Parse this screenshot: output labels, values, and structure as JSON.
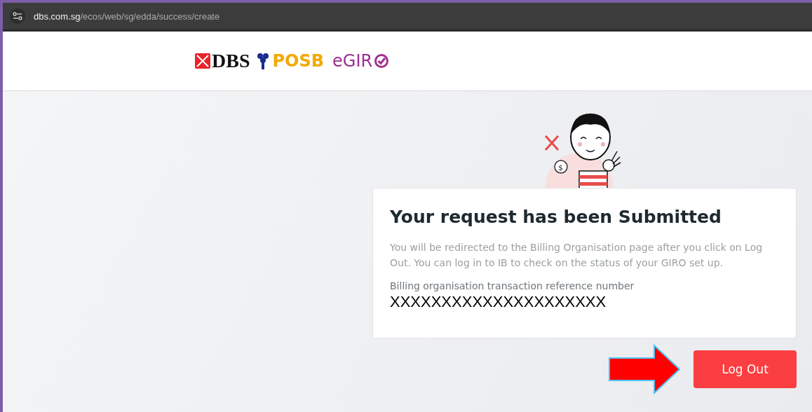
{
  "browser": {
    "url_host": "dbs.com.sg",
    "url_path": "/ecos/web/sg/edda/success/create"
  },
  "header": {
    "logos": [
      {
        "text": "DBS",
        "kind": "dbs"
      },
      {
        "text": "POSB",
        "kind": "posb"
      },
      {
        "text": "eGIR",
        "kind": "egiro"
      }
    ]
  },
  "illustration": {
    "coin_symbol": "$"
  },
  "card": {
    "title": "Your request has been Submitted",
    "message": "You will be redirected to the Billing Organisation page after you click on Log Out. You can log in to IB to check on the status of your GIRO set up.",
    "reference_label": "Billing organisation transaction reference number",
    "reference_value": "XXXXXXXXXXXXXXXXXXXXX"
  },
  "buttons": [
    {
      "label": "Log Out"
    }
  ]
}
